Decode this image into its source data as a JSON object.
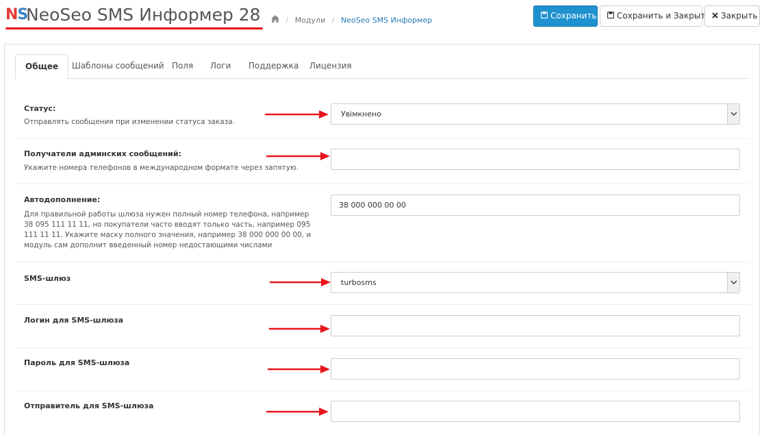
{
  "header": {
    "logo_n": "N",
    "logo_s": "S",
    "title": "NeoSeo SMS Информер 28",
    "home_icon": "home-icon",
    "breadcrumbs": [
      "Модули",
      "NeoSeo SMS Информер"
    ],
    "buttons": {
      "save": "Сохранить",
      "save_close": "Сохранить и Закрыть",
      "close": "Закрыть"
    },
    "accent_color": "#1e91cf",
    "underline_color": "#e8141c"
  },
  "tabs": [
    {
      "label": "Общее",
      "active": true
    },
    {
      "label": "Шаблоны сообщений",
      "active": false
    },
    {
      "label": "Поля",
      "active": false
    },
    {
      "label": "Логи",
      "active": false
    },
    {
      "label": "Поддержка",
      "active": false
    },
    {
      "label": "Лицензия",
      "active": false
    }
  ],
  "fields": {
    "status": {
      "label": "Статус:",
      "help": "Отправлять сообщения при изменении статуса заказа.",
      "value": "Увімкнено"
    },
    "admin_recipients": {
      "label": "Получатели админских сообщений:",
      "help": "Укажите номера телефонов в международном формате через запятую.",
      "value": ""
    },
    "autocomplete": {
      "label": "Автодополнение:",
      "help": "Для правильной работы шлюза нужен полный номер телефона, например 38 095 111 11 11, но покупатели часто вводят только часть, например 095 111 11 11. Укажите маску полного значения, например 38 000 000 00 00, и модуль сам дополнит введенный номер недостающими числами",
      "value": "38 000 000 00 00"
    },
    "gateway": {
      "label": "SMS-шлюз",
      "value": "turbosms"
    },
    "login": {
      "label": "Логин для SMS-шлюза",
      "value": ""
    },
    "password": {
      "label": "Пароль для SMS-шлюза",
      "value": ""
    },
    "sender": {
      "label": "Отправитель для SMS-шлюза",
      "value": ""
    }
  },
  "annotation_color": "#e8141c"
}
